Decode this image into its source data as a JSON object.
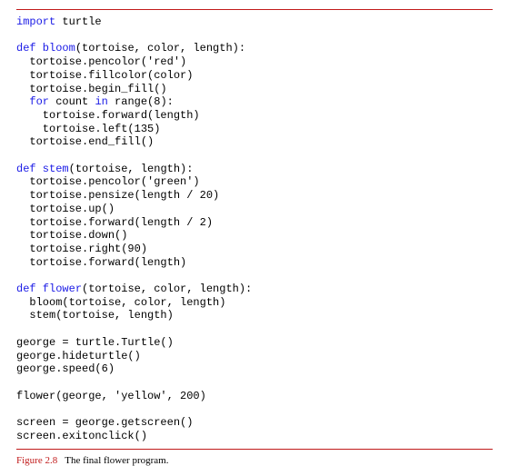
{
  "code": {
    "l01_kw": "import",
    "l01_rest": " turtle",
    "blank1": "",
    "l02_kw": "def",
    "l02_fn": " bloom",
    "l02_rest": "(tortoise, color, length):",
    "l03": "  tortoise.pencolor('red')",
    "l04": "  tortoise.fillcolor(color)",
    "l05": "  tortoise.begin_fill()",
    "l06_ind": "  ",
    "l06_kw1": "for",
    "l06_mid": " count ",
    "l06_kw2": "in",
    "l06_rest": " range(8):",
    "l07": "    tortoise.forward(length)",
    "l08": "    tortoise.left(135)",
    "l09": "  tortoise.end_fill()",
    "blank2": "",
    "l10_kw": "def",
    "l10_fn": " stem",
    "l10_rest": "(tortoise, length):",
    "l11": "  tortoise.pencolor('green')",
    "l12": "  tortoise.pensize(length / 20)",
    "l13": "  tortoise.up()",
    "l14": "  tortoise.forward(length / 2)",
    "l15": "  tortoise.down()",
    "l16": "  tortoise.right(90)",
    "l17": "  tortoise.forward(length)",
    "blank3": "",
    "l18_kw": "def",
    "l18_fn": " flower",
    "l18_rest": "(tortoise, color, length):",
    "l19": "  bloom(tortoise, color, length)",
    "l20": "  stem(tortoise, length)",
    "blank4": "",
    "l21": "george = turtle.Turtle()",
    "l22": "george.hideturtle()",
    "l23": "george.speed(6)",
    "blank5": "",
    "l24": "flower(george, 'yellow', 200)",
    "blank6": "",
    "l25": "screen = george.getscreen()",
    "l26": "screen.exitonclick()"
  },
  "caption": {
    "label": "Figure 2.8",
    "text": "The final flower program."
  }
}
